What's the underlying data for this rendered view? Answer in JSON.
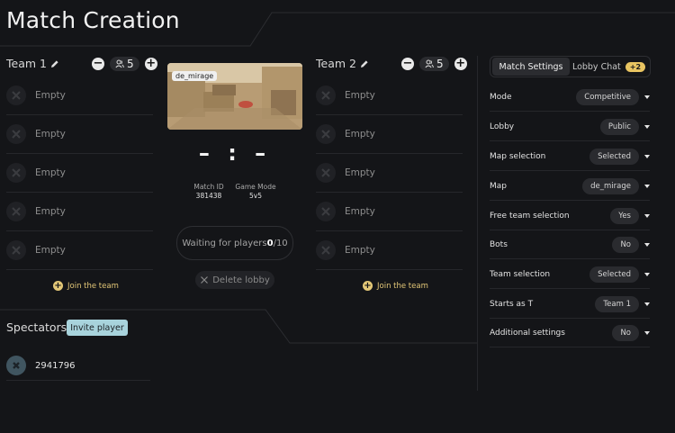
{
  "page": {
    "title": "Match Creation"
  },
  "team1": {
    "name": "Team 1",
    "count": "5",
    "join_label": "Join the team",
    "slots": [
      "Empty",
      "Empty",
      "Empty",
      "Empty",
      "Empty"
    ]
  },
  "team2": {
    "name": "Team 2",
    "count": "5",
    "join_label": "Join the team",
    "slots": [
      "Empty",
      "Empty",
      "Empty",
      "Empty",
      "Empty"
    ]
  },
  "match": {
    "map_name": "de_mirage",
    "score": "– : –",
    "match_id_label": "Match ID",
    "match_id": "381438",
    "game_mode_label": "Game Mode",
    "game_mode": "5v5",
    "waiting_prefix": "Waiting for players ",
    "waiting_current": "0",
    "waiting_total": "/10",
    "delete_label": "Delete lobby"
  },
  "spectators": {
    "title": "Spectators",
    "invite_label": "Invite player",
    "items": [
      {
        "name": "2941796"
      }
    ]
  },
  "sidebar": {
    "tabs": [
      {
        "label": "Match Settings",
        "active": true
      },
      {
        "label": "Lobby Chat",
        "badge": "+2"
      }
    ],
    "settings": [
      {
        "label": "Mode",
        "value": "Competitive"
      },
      {
        "label": "Lobby",
        "value": "Public"
      },
      {
        "label": "Map selection",
        "value": "Selected"
      },
      {
        "label": "Map",
        "value": "de_mirage"
      },
      {
        "label": "Free team selection",
        "value": "Yes"
      },
      {
        "label": "Bots",
        "value": "No"
      },
      {
        "label": "Team selection",
        "value": "Selected"
      },
      {
        "label": "Starts as T",
        "value": "Team 1"
      },
      {
        "label": "Additional settings",
        "value": "No"
      }
    ]
  },
  "colors": {
    "background": "#141518",
    "accent_gold": "#e3c777",
    "invite_bg": "#a8d3dc"
  },
  "icons": [
    "pencil-icon",
    "minus-icon",
    "users-icon",
    "plus-icon",
    "empty-slot-icon",
    "join-plus-icon",
    "close-icon",
    "avatar-icon",
    "chevron-down-icon"
  ]
}
